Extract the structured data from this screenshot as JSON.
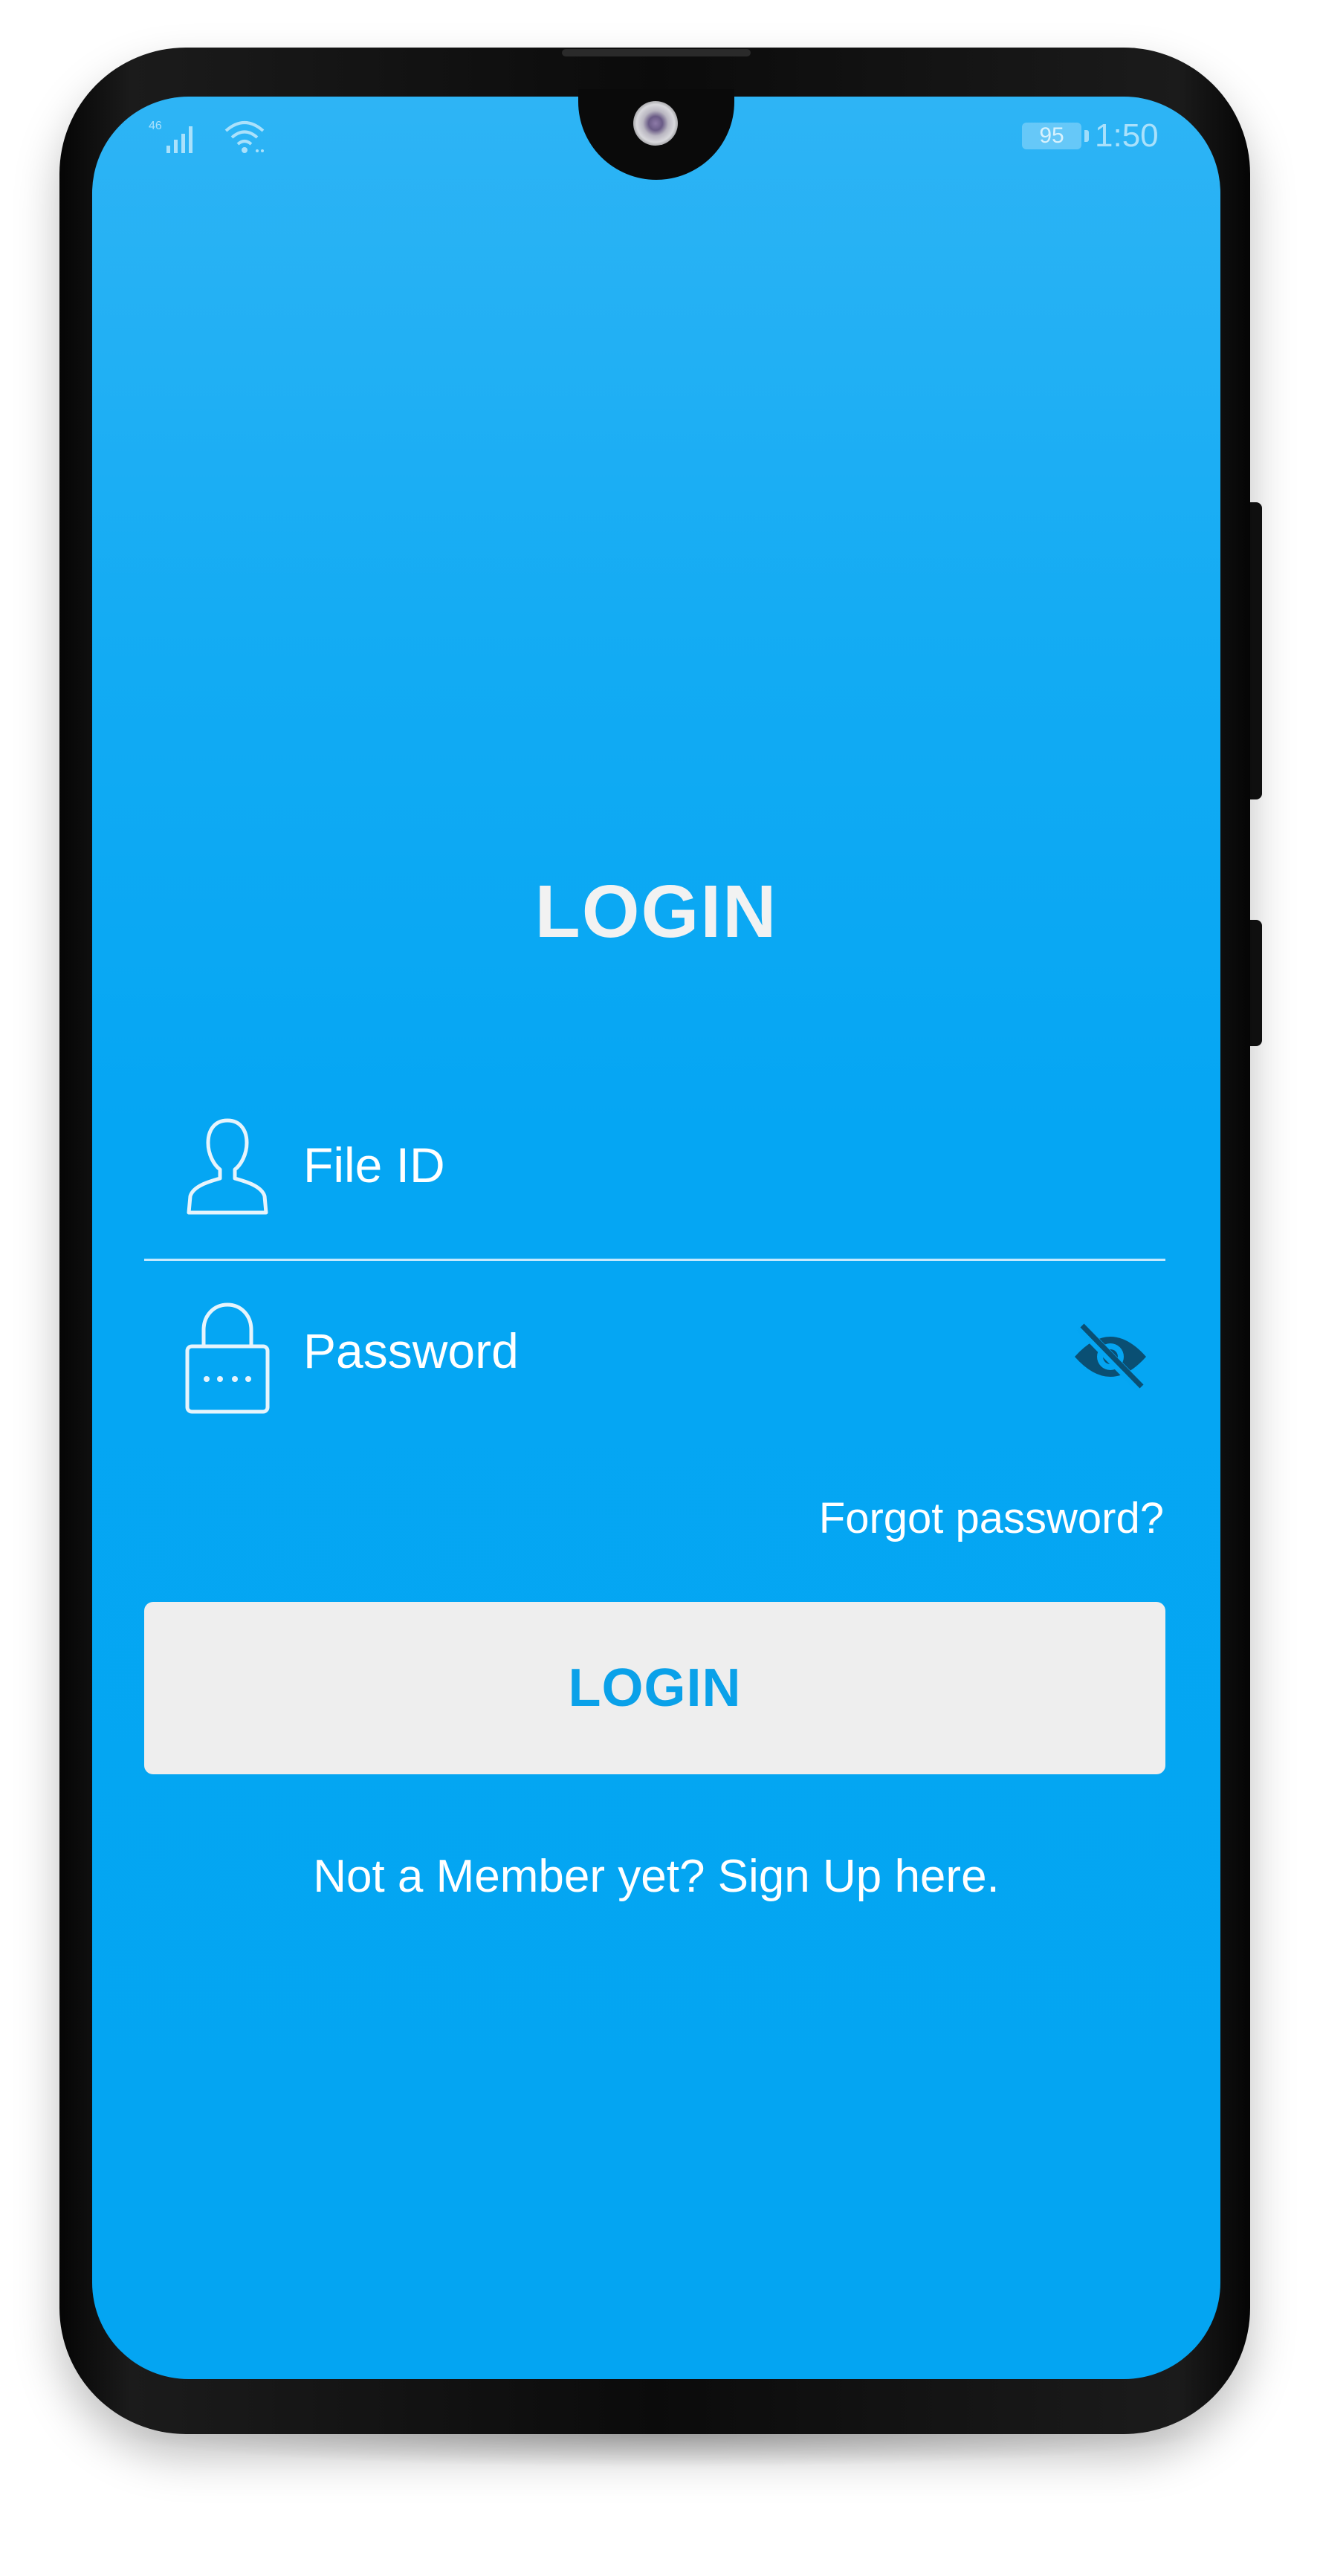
{
  "status_bar": {
    "battery": "95",
    "time": "1:50",
    "signal_icon": "signal-icon",
    "wifi_icon": "wifi-icon"
  },
  "login": {
    "title": "LOGIN",
    "file_id_placeholder": "File ID",
    "password_placeholder": "Password",
    "forgot_password": "Forgot password?",
    "login_button": "LOGIN",
    "signup_text": "Not a Member yet? Sign Up here."
  },
  "colors": {
    "background": "#04a5f2",
    "button_bg": "#eeeeee",
    "button_text": "#0aa1e9",
    "eye_icon": "#0a4f73"
  }
}
